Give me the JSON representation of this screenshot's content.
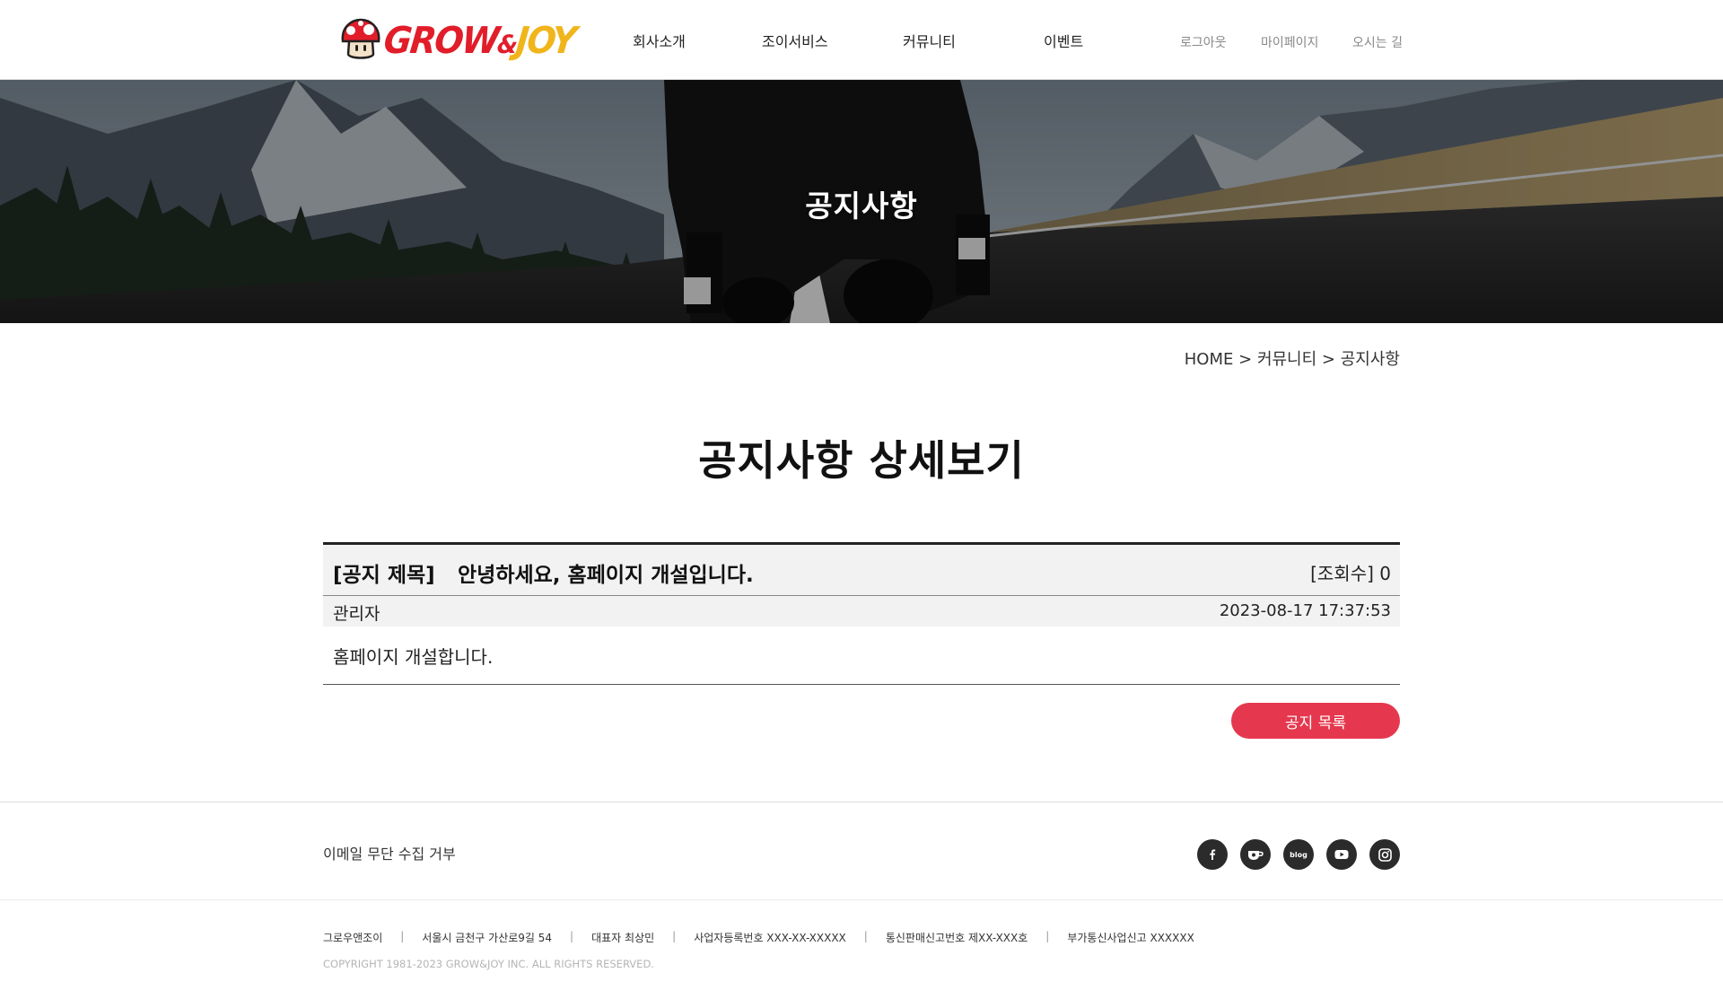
{
  "header": {
    "logo": {
      "text_part1": "GROW",
      "text_amp": "&",
      "text_part2": "JOY"
    },
    "gnb": [
      "회사소개",
      "조이서비스",
      "커뮤니티",
      "이벤트"
    ],
    "util": [
      "로그아웃",
      "마이페이지",
      "오시는 길"
    ]
  },
  "banner": {
    "title": "공지사항"
  },
  "breadcrumb": {
    "home": "HOME",
    "sep": ">",
    "level1": "커뮤니티",
    "level2": "공지사항"
  },
  "page": {
    "title": "공지사항 상세보기"
  },
  "notice": {
    "label": "[공지 제목]",
    "subject": "안녕하세요, 홈페이지 개설입니다.",
    "views_label": "[조회수] 0",
    "author": "관리자",
    "date": "2023-08-17 17:37:53",
    "content": "홈페이지 개설합니다."
  },
  "actions": {
    "list_label": "공지 목록"
  },
  "footer": {
    "email_refuse": "이메일 무단 수집 거부",
    "sns": [
      "facebook-icon",
      "cafe-icon",
      "blog-icon",
      "youtube-icon",
      "instagram-icon"
    ],
    "sns_blog_text": "blog",
    "info": [
      "그로우앤조이",
      "서울시 금천구 가산로9길 54",
      "대표자 최상민",
      "사업자등록번호 XXX-XX-XXXXX",
      "통신판매신고번호 제XX-XXX호",
      "부가통신사업신고 XXXXXX"
    ],
    "info_sep": "|",
    "copyright": "COPYRIGHT 1981-2023 GROW&JOY INC. ALL RIGHTS RESERVED."
  },
  "colors": {
    "brand_red": "#e21d2a",
    "brand_yellow": "#f1b51c",
    "button_red": "#e5384e",
    "sns_dark": "#2b2b2b"
  }
}
